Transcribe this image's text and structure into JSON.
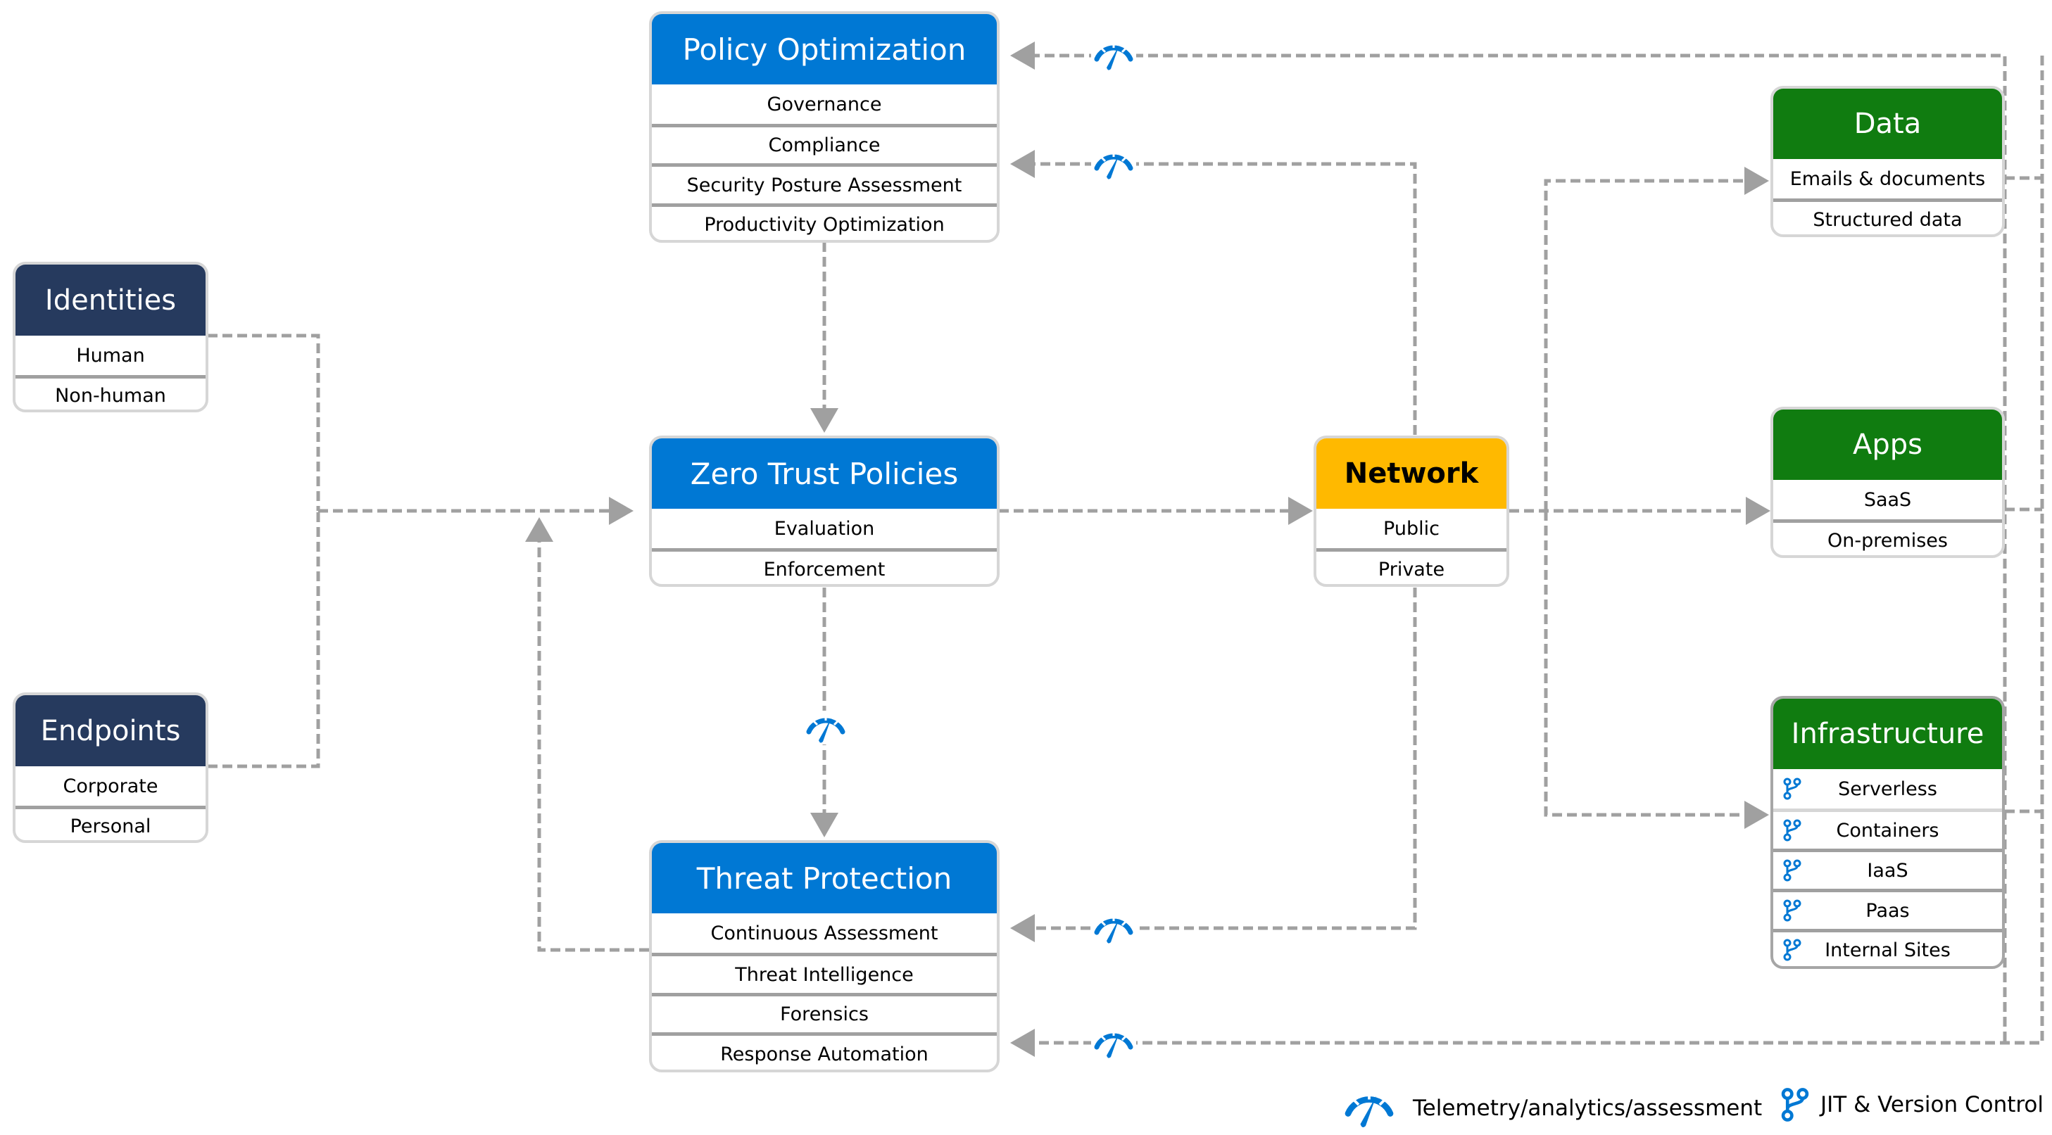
{
  "colors": {
    "navy": "#263a5e",
    "blue": "#0078d4",
    "green": "#107c10",
    "amber": "#ffb900",
    "connector": "#a0a0a0",
    "icon": "#0078d4"
  },
  "nodes": {
    "identities": {
      "title": "Identities",
      "items": [
        "Human",
        "Non-human"
      ]
    },
    "endpoints": {
      "title": "Endpoints",
      "items": [
        "Corporate",
        "Personal"
      ]
    },
    "policy_optimization": {
      "title": "Policy Optimization",
      "items": [
        "Governance",
        "Compliance",
        "Security Posture Assessment",
        "Productivity Optimization"
      ]
    },
    "zero_trust_policies": {
      "title": "Zero Trust Policies",
      "items": [
        "Evaluation",
        "Enforcement"
      ]
    },
    "threat_protection": {
      "title": "Threat Protection",
      "items": [
        "Continuous Assessment",
        "Threat Intelligence",
        "Forensics",
        "Response Automation"
      ]
    },
    "network": {
      "title": "Network",
      "items": [
        "Public",
        "Private"
      ]
    },
    "data": {
      "title": "Data",
      "items": [
        "Emails & documents",
        "Structured data"
      ]
    },
    "apps": {
      "title": "Apps",
      "items": [
        "SaaS",
        "On-premises"
      ]
    },
    "infrastructure": {
      "title": "Infrastructure",
      "items": [
        "Serverless",
        "Containers",
        "IaaS",
        "Paas",
        "Internal Sites"
      ]
    }
  },
  "legend": {
    "telemetry": {
      "icon": "gauge-icon",
      "label": "Telemetry/analytics/assessment"
    },
    "jit": {
      "icon": "branch-icon",
      "label": "JIT & Version Control"
    }
  }
}
